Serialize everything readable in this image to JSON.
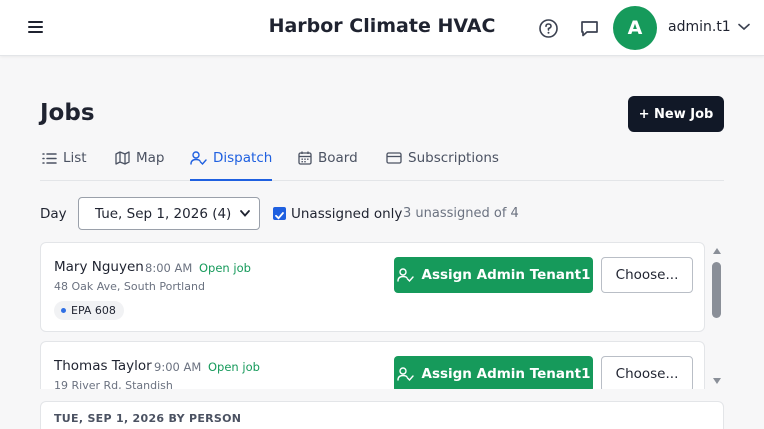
{
  "header": {
    "app_title": "Harbor Climate HVAC",
    "avatar_initial": "A",
    "username": "admin.t1"
  },
  "page": {
    "title": "Jobs",
    "new_job_label": "+ New Job"
  },
  "tabs": [
    {
      "label": "List",
      "icon": "list-icon",
      "active": false
    },
    {
      "label": "Map",
      "icon": "map-icon",
      "active": false
    },
    {
      "label": "Dispatch",
      "icon": "dispatch-user-icon",
      "active": true
    },
    {
      "label": "Board",
      "icon": "calendar-icon",
      "active": false
    },
    {
      "label": "Subscriptions",
      "icon": "card-icon",
      "active": false
    }
  ],
  "filters": {
    "day_label": "Day",
    "day_value": "Tue, Sep 1, 2026 (4)",
    "unassigned_only_label": "Unassigned only",
    "unassigned_only_checked": true,
    "count_text": "3 unassigned of 4"
  },
  "jobs": [
    {
      "customer": "Mary Nguyen",
      "time": "8:00 AM",
      "status": "Open job",
      "address": "48 Oak Ave, South Portland",
      "tag": "EPA 608",
      "assign_label": "Assign Admin Tenant1",
      "choose_label": "Choose..."
    },
    {
      "customer": "Thomas Taylor",
      "time": "9:00 AM",
      "status": "Open job",
      "address": "19 River Rd, Standish",
      "assign_label": "Assign Admin Tenant1",
      "choose_label": "Choose..."
    }
  ],
  "by_person": {
    "title": "TUE, SEP 1, 2026 BY PERSON"
  },
  "colors": {
    "accent_blue": "#1f60e0",
    "assign_green": "#169a5b",
    "dark_button": "#111827"
  }
}
